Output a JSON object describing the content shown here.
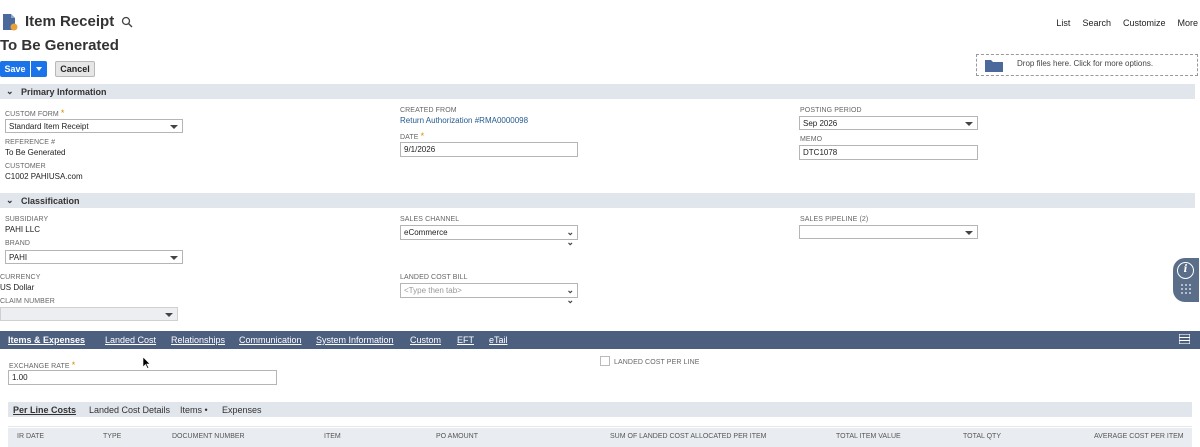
{
  "header": {
    "title": "Item Receipt",
    "subtitle": "To Be Generated",
    "nav": [
      "List",
      "Search",
      "Customize",
      "More"
    ]
  },
  "toolbar": {
    "save_label": "Save",
    "cancel_label": "Cancel"
  },
  "dropzone": {
    "text": "Drop files here. Click for more options."
  },
  "primary": {
    "section_label": "Primary Information",
    "custom_form": {
      "label": "CUSTOM FORM",
      "value": "Standard Item Receipt"
    },
    "reference": {
      "label": "REFERENCE #",
      "value": "To Be Generated"
    },
    "customer": {
      "label": "CUSTOMER",
      "value": "C1002 PAHIUSA.com"
    },
    "created_from": {
      "label": "CREATED FROM",
      "value": "Return Authorization #RMA0000098"
    },
    "date": {
      "label": "DATE",
      "value": "9/1/2026"
    },
    "posting_period": {
      "label": "POSTING PERIOD",
      "value": "Sep 2026"
    },
    "memo": {
      "label": "MEMO",
      "value": "DTC1078"
    }
  },
  "classification": {
    "section_label": "Classification",
    "subsidiary": {
      "label": "SUBSIDIARY",
      "value": "PAHI LLC"
    },
    "brand": {
      "label": "BRAND",
      "value": "PAHI"
    },
    "currency": {
      "label": "CURRENCY",
      "value": "US Dollar"
    },
    "claim_number": {
      "label": "CLAIM NUMBER",
      "value": ""
    },
    "sales_channel": {
      "label": "SALES CHANNEL",
      "value": "eCommerce"
    },
    "landed_cost_bill": {
      "label": "LANDED COST BILL",
      "placeholder": "<Type then tab>"
    },
    "sales_pipeline": {
      "label": "SALES PIPELINE (2)",
      "value": ""
    }
  },
  "tabs": [
    "Items & Expenses",
    "Landed Cost",
    "Relationships",
    "Communication",
    "System Information",
    "Custom",
    "EFT",
    "eTail"
  ],
  "items_tab": {
    "exchange_rate": {
      "label": "EXCHANGE RATE",
      "value": "1.00"
    },
    "landed_cost_per_line": {
      "label": "LANDED COST PER LINE"
    },
    "subtabs": [
      "Per Line Costs",
      "Landed Cost Details",
      "Items •",
      "Expenses"
    ],
    "columns": [
      "IR DATE",
      "TYPE",
      "DOCUMENT NUMBER",
      "ITEM",
      "PO AMOUNT",
      "SUM OF LANDED COST ALLOCATED PER ITEM",
      "TOTAL ITEM VALUE",
      "TOTAL QTY",
      "AVERAGE COST PER ITEM"
    ]
  },
  "colors": {
    "primary_button": "#1a73e8",
    "tab_bar": "#4d5f7f",
    "section_bar": "#e1e5ec",
    "required": "#d98b00",
    "link": "#255b8f"
  }
}
